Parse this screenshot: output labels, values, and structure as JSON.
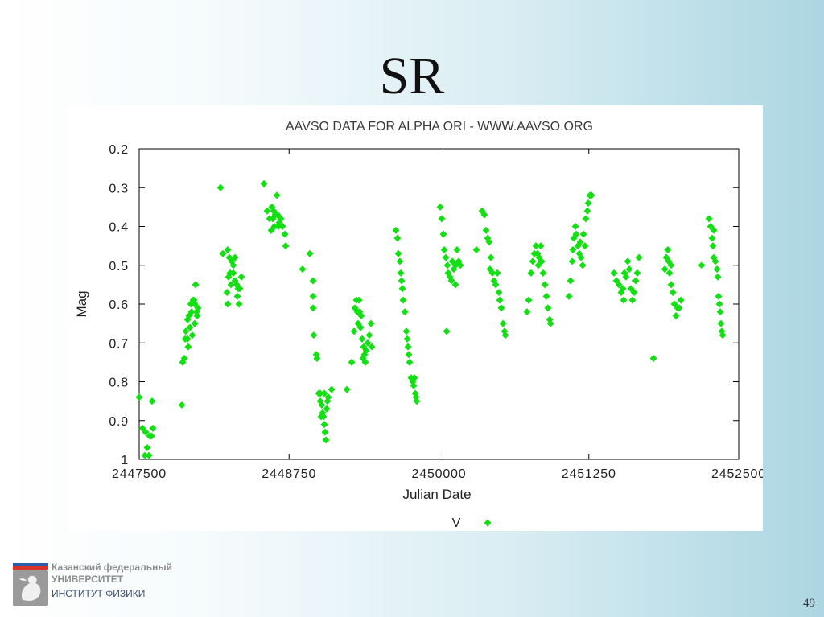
{
  "slide": {
    "title": "SR",
    "page_number": "49"
  },
  "logo": {
    "icon": "kfu-emblem-icon",
    "line1": "Казанский федеральный",
    "line2": "УНИВЕРСИТЕТ",
    "line3": "ИНСТИТУТ ФИЗИКИ",
    "colors": {
      "blue": "#2b5ea8",
      "red": "#d8322a",
      "emblem": "#9a9a9a"
    }
  },
  "chart_data": {
    "type": "scatter",
    "title": "AAVSO DATA FOR ALPHA ORI - WWW.AAVSO.ORG",
    "xlabel": "Julian Date",
    "ylabel": "Mag",
    "xlim": [
      2447500,
      2452500
    ],
    "ylim": [
      0.2,
      1
    ],
    "y_inverted": true,
    "grid": false,
    "legend_position": "bottom-center",
    "x_ticks": [
      2447500,
      2448750,
      2450000,
      2451250,
      2452500
    ],
    "x_tick_labels": [
      "2447500",
      "2448750",
      "2450000",
      "2451250",
      "2452500"
    ],
    "y_ticks": [
      0.2,
      0.3,
      0.4,
      0.5,
      0.6,
      0.7,
      0.8,
      0.9,
      1.0
    ],
    "y_tick_labels": [
      "0.2",
      "0.3",
      "0.4",
      "0.5",
      "0.6",
      "0.7",
      "0.8",
      "0.9",
      "1"
    ],
    "series": [
      {
        "name": "V",
        "color": "#12e012",
        "points": [
          [
            2447500,
            0.84
          ],
          [
            2447527,
            0.92
          ],
          [
            2447554,
            0.93
          ],
          [
            2447567,
            0.97
          ],
          [
            2447581,
            0.99
          ],
          [
            2447547,
            0.99
          ],
          [
            2447587,
            0.94
          ],
          [
            2447607,
            0.85
          ],
          [
            2447601,
            0.94
          ],
          [
            2447614,
            0.92
          ],
          [
            2447856,
            0.86
          ],
          [
            2447862,
            0.75
          ],
          [
            2447876,
            0.74
          ],
          [
            2447883,
            0.69
          ],
          [
            2447889,
            0.67
          ],
          [
            2447903,
            0.64
          ],
          [
            2447916,
            0.63
          ],
          [
            2447923,
            0.66
          ],
          [
            2447930,
            0.6
          ],
          [
            2447936,
            0.62
          ],
          [
            2447950,
            0.59
          ],
          [
            2447956,
            0.59
          ],
          [
            2447963,
            0.6
          ],
          [
            2447970,
            0.55
          ],
          [
            2447977,
            0.62
          ],
          [
            2447983,
            0.63
          ],
          [
            2447990,
            0.61
          ],
          [
            2447963,
            0.65
          ],
          [
            2447943,
            0.68
          ],
          [
            2447909,
            0.71
          ],
          [
            2447903,
            0.69
          ],
          [
            2448178,
            0.3
          ],
          [
            2448198,
            0.47
          ],
          [
            2448238,
            0.46
          ],
          [
            2448252,
            0.48
          ],
          [
            2448272,
            0.49
          ],
          [
            2448285,
            0.5
          ],
          [
            2448245,
            0.53
          ],
          [
            2448265,
            0.55
          ],
          [
            2448285,
            0.52
          ],
          [
            2448299,
            0.54
          ],
          [
            2448312,
            0.55
          ],
          [
            2448326,
            0.56
          ],
          [
            2448339,
            0.56
          ],
          [
            2448352,
            0.53
          ],
          [
            2448319,
            0.58
          ],
          [
            2448332,
            0.6
          ],
          [
            2448232,
            0.57
          ],
          [
            2448238,
            0.6
          ],
          [
            2448258,
            0.52
          ],
          [
            2448299,
            0.48
          ],
          [
            2448540,
            0.29
          ],
          [
            2448567,
            0.36
          ],
          [
            2448587,
            0.38
          ],
          [
            2448607,
            0.35
          ],
          [
            2448621,
            0.36
          ],
          [
            2448634,
            0.37
          ],
          [
            2448648,
            0.32
          ],
          [
            2448654,
            0.37
          ],
          [
            2448668,
            0.39
          ],
          [
            2448681,
            0.38
          ],
          [
            2448695,
            0.4
          ],
          [
            2448715,
            0.42
          ],
          [
            2448721,
            0.45
          ],
          [
            2448601,
            0.41
          ],
          [
            2448628,
            0.4
          ],
          [
            2448661,
            0.4
          ],
          [
            2448614,
            0.38
          ],
          [
            2448862,
            0.51
          ],
          [
            2448923,
            0.47
          ],
          [
            2448950,
            0.54
          ],
          [
            2448950,
            0.58
          ],
          [
            2448950,
            0.61
          ],
          [
            2448956,
            0.68
          ],
          [
            2448977,
            0.73
          ],
          [
            2448983,
            0.74
          ],
          [
            2448997,
            0.83
          ],
          [
            2449010,
            0.85
          ],
          [
            2449023,
            0.86
          ],
          [
            2449030,
            0.88
          ],
          [
            2449037,
            0.89
          ],
          [
            2449044,
            0.91
          ],
          [
            2449050,
            0.93
          ],
          [
            2449057,
            0.95
          ],
          [
            2449017,
            0.89
          ],
          [
            2449064,
            0.87
          ],
          [
            2449070,
            0.85
          ],
          [
            2449077,
            0.84
          ],
          [
            2449104,
            0.82
          ],
          [
            2449010,
            0.83
          ],
          [
            2449044,
            0.83
          ],
          [
            2449232,
            0.82
          ],
          [
            2449272,
            0.75
          ],
          [
            2449292,
            0.67
          ],
          [
            2449299,
            0.61
          ],
          [
            2449312,
            0.59
          ],
          [
            2449319,
            0.62
          ],
          [
            2449325,
            0.65
          ],
          [
            2449339,
            0.62
          ],
          [
            2449346,
            0.66
          ],
          [
            2449359,
            0.69
          ],
          [
            2449372,
            0.71
          ],
          [
            2449379,
            0.73
          ],
          [
            2449386,
            0.75
          ],
          [
            2449393,
            0.72
          ],
          [
            2449406,
            0.7
          ],
          [
            2449419,
            0.68
          ],
          [
            2449433,
            0.65
          ],
          [
            2449440,
            0.71
          ],
          [
            2449332,
            0.59
          ],
          [
            2449352,
            0.63
          ],
          [
            2449366,
            0.74
          ],
          [
            2449641,
            0.41
          ],
          [
            2449654,
            0.43
          ],
          [
            2449661,
            0.47
          ],
          [
            2449674,
            0.49
          ],
          [
            2449681,
            0.52
          ],
          [
            2449688,
            0.54
          ],
          [
            2449695,
            0.56
          ],
          [
            2449701,
            0.59
          ],
          [
            2449715,
            0.62
          ],
          [
            2449728,
            0.67
          ],
          [
            2449735,
            0.69
          ],
          [
            2449742,
            0.71
          ],
          [
            2449748,
            0.73
          ],
          [
            2449755,
            0.75
          ],
          [
            2449768,
            0.79
          ],
          [
            2449782,
            0.8
          ],
          [
            2449789,
            0.81
          ],
          [
            2449802,
            0.83
          ],
          [
            2449809,
            0.84
          ],
          [
            2449815,
            0.85
          ],
          [
            2449795,
            0.79
          ],
          [
            2450010,
            0.35
          ],
          [
            2450023,
            0.38
          ],
          [
            2450037,
            0.42
          ],
          [
            2450044,
            0.46
          ],
          [
            2450057,
            0.48
          ],
          [
            2450070,
            0.5
          ],
          [
            2450064,
            0.67
          ],
          [
            2450077,
            0.52
          ],
          [
            2450091,
            0.53
          ],
          [
            2450104,
            0.54
          ],
          [
            2450111,
            0.49
          ],
          [
            2450124,
            0.51
          ],
          [
            2450138,
            0.5
          ],
          [
            2450151,
            0.46
          ],
          [
            2450164,
            0.49
          ],
          [
            2450178,
            0.5
          ],
          [
            2450138,
            0.55
          ],
          [
            2450312,
            0.46
          ],
          [
            2450359,
            0.36
          ],
          [
            2450379,
            0.37
          ],
          [
            2450393,
            0.41
          ],
          [
            2450406,
            0.43
          ],
          [
            2450419,
            0.44
          ],
          [
            2450433,
            0.48
          ],
          [
            2450446,
            0.52
          ],
          [
            2450460,
            0.54
          ],
          [
            2450473,
            0.55
          ],
          [
            2450487,
            0.52
          ],
          [
            2450500,
            0.57
          ],
          [
            2450507,
            0.59
          ],
          [
            2450520,
            0.61
          ],
          [
            2450534,
            0.65
          ],
          [
            2450547,
            0.67
          ],
          [
            2450554,
            0.68
          ],
          [
            2450426,
            0.51
          ],
          [
            2450735,
            0.62
          ],
          [
            2450748,
            0.59
          ],
          [
            2450768,
            0.52
          ],
          [
            2450782,
            0.49
          ],
          [
            2450795,
            0.47
          ],
          [
            2450809,
            0.45
          ],
          [
            2450822,
            0.47
          ],
          [
            2450836,
            0.48
          ],
          [
            2450849,
            0.45
          ],
          [
            2450856,
            0.49
          ],
          [
            2450869,
            0.52
          ],
          [
            2450883,
            0.55
          ],
          [
            2450896,
            0.58
          ],
          [
            2450909,
            0.61
          ],
          [
            2450923,
            0.64
          ],
          [
            2450930,
            0.65
          ],
          [
            2450829,
            0.5
          ],
          [
            2451084,
            0.58
          ],
          [
            2451097,
            0.54
          ],
          [
            2451111,
            0.49
          ],
          [
            2451117,
            0.46
          ],
          [
            2451124,
            0.43
          ],
          [
            2451138,
            0.4
          ],
          [
            2451144,
            0.42
          ],
          [
            2451158,
            0.45
          ],
          [
            2451171,
            0.47
          ],
          [
            2451178,
            0.44
          ],
          [
            2451185,
            0.48
          ],
          [
            2451198,
            0.5
          ],
          [
            2451205,
            0.42
          ],
          [
            2451218,
            0.45
          ],
          [
            2451225,
            0.38
          ],
          [
            2451238,
            0.36
          ],
          [
            2451245,
            0.34
          ],
          [
            2451258,
            0.32
          ],
          [
            2451272,
            0.32
          ],
          [
            2451460,
            0.52
          ],
          [
            2451480,
            0.54
          ],
          [
            2451500,
            0.55
          ],
          [
            2451520,
            0.57
          ],
          [
            2451534,
            0.56
          ],
          [
            2451547,
            0.52
          ],
          [
            2451560,
            0.53
          ],
          [
            2451574,
            0.49
          ],
          [
            2451587,
            0.51
          ],
          [
            2451601,
            0.56
          ],
          [
            2451614,
            0.59
          ],
          [
            2451628,
            0.57
          ],
          [
            2451641,
            0.54
          ],
          [
            2451654,
            0.52
          ],
          [
            2451668,
            0.48
          ],
          [
            2451540,
            0.59
          ],
          [
            2451789,
            0.74
          ],
          [
            2451883,
            0.51
          ],
          [
            2451896,
            0.48
          ],
          [
            2451909,
            0.46
          ],
          [
            2451916,
            0.49
          ],
          [
            2451923,
            0.52
          ],
          [
            2451936,
            0.55
          ],
          [
            2451950,
            0.57
          ],
          [
            2451963,
            0.6
          ],
          [
            2451977,
            0.63
          ],
          [
            2451990,
            0.61
          ],
          [
            2452003,
            0.61
          ],
          [
            2452017,
            0.59
          ],
          [
            2451936,
            0.5
          ],
          [
            2452191,
            0.5
          ],
          [
            2452252,
            0.38
          ],
          [
            2452265,
            0.4
          ],
          [
            2452278,
            0.43
          ],
          [
            2452285,
            0.45
          ],
          [
            2452292,
            0.41
          ],
          [
            2452305,
            0.49
          ],
          [
            2452319,
            0.51
          ],
          [
            2452326,
            0.53
          ],
          [
            2452332,
            0.58
          ],
          [
            2452339,
            0.6
          ],
          [
            2452346,
            0.62
          ],
          [
            2452352,
            0.65
          ],
          [
            2452359,
            0.67
          ],
          [
            2452366,
            0.68
          ],
          [
            2452292,
            0.48
          ]
        ]
      }
    ]
  }
}
